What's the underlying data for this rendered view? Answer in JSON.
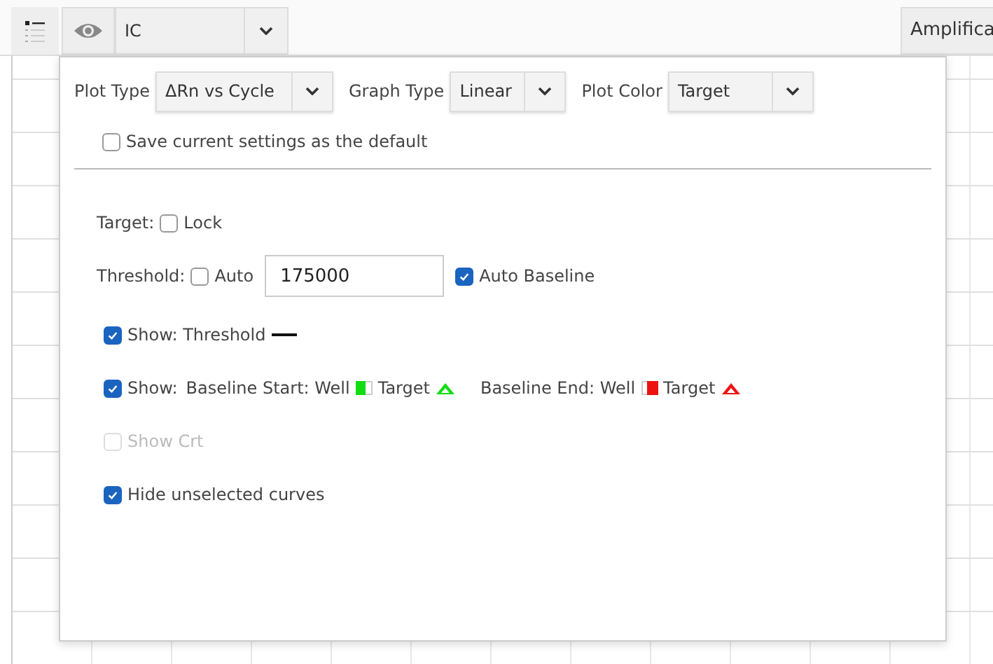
{
  "toolbar": {
    "view_select": {
      "value": "IC"
    },
    "right_button": "Amplifica"
  },
  "popup": {
    "dropdowns": [
      {
        "label": "Plot Type",
        "value": "ΔRn vs Cycle"
      },
      {
        "label": "Graph Type",
        "value": "Linear"
      },
      {
        "label": "Plot Color",
        "value": "Target"
      }
    ],
    "save_default": {
      "label": "Save current settings as the default",
      "checked": false
    },
    "target": {
      "label": "Target:",
      "lock": {
        "label": "Lock",
        "checked": false
      }
    },
    "threshold": {
      "label": "Threshold:",
      "auto": {
        "label": "Auto",
        "checked": false
      },
      "value": "175000",
      "auto_baseline": {
        "label": "Auto Baseline",
        "checked": true
      }
    },
    "show_threshold": {
      "label": "Show: Threshold",
      "checked": true
    },
    "show_baseline": {
      "label": "Show:",
      "checked": true,
      "markers": [
        {
          "well_label": "Baseline Start: Well",
          "target_label": "Target",
          "color": "#11dd11"
        },
        {
          "well_label": "Baseline End: Well",
          "target_label": "Target",
          "color": "#ee1111"
        }
      ]
    },
    "show_crt": {
      "label": "Show Crt",
      "checked": false,
      "disabled": true
    },
    "hide_unselected": {
      "label": "Hide unselected curves",
      "checked": true
    }
  }
}
